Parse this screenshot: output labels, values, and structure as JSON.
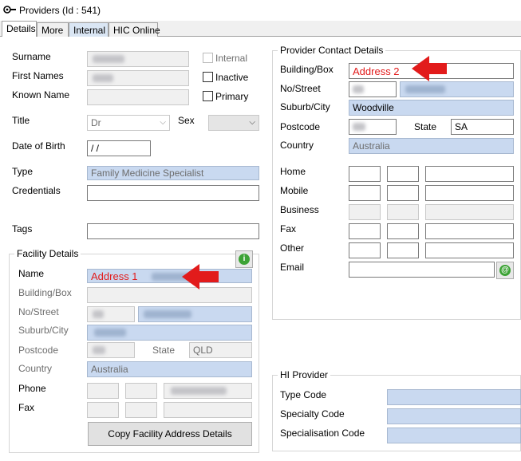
{
  "window": {
    "title": "Providers (Id : 541)"
  },
  "tabs": [
    {
      "label": "Details"
    },
    {
      "label": "More"
    },
    {
      "label": "Internal"
    },
    {
      "label": "HIC Online"
    }
  ],
  "personal": {
    "surname_label": "Surname",
    "first_names_label": "First Names",
    "known_name_label": "Known Name",
    "title_label": "Title",
    "title_value": "Dr",
    "sex_label": "Sex",
    "dob_label": "Date of Birth",
    "dob_value": "/ /",
    "type_label": "Type",
    "type_value": "Family Medicine Specialist",
    "credentials_label": "Credentials",
    "tags_label": "Tags",
    "internal_label": "Internal",
    "inactive_label": "Inactive",
    "primary_label": "Primary"
  },
  "facility": {
    "group_title": "Facility Details",
    "name_label": "Name",
    "name_annotation": "Address 1",
    "building_label": "Building/Box",
    "street_label": "No/Street",
    "suburb_label": "Suburb/City",
    "postcode_label": "Postcode",
    "state_label": "State",
    "state_value": "QLD",
    "country_label": "Country",
    "country_value": "Australia",
    "phone_label": "Phone",
    "fax_label": "Fax",
    "copy_button": "Copy Facility Address Details",
    "info_icon_glyph": "i"
  },
  "contact": {
    "group_title": "Provider Contact Details",
    "building_label": "Building/Box",
    "building_annotation": "Address 2",
    "street_label": "No/Street",
    "suburb_label": "Suburb/City",
    "suburb_value": "Woodville",
    "postcode_label": "Postcode",
    "state_label": "State",
    "state_value": "SA",
    "country_label": "Country",
    "country_value": "Australia",
    "home_label": "Home",
    "mobile_label": "Mobile",
    "business_label": "Business",
    "fax_label": "Fax",
    "other_label": "Other",
    "email_label": "Email",
    "email_icon_glyph": "@"
  },
  "hi_provider": {
    "group_title": "HI Provider",
    "type_code_label": "Type Code",
    "specialty_code_label": "Specialty Code",
    "specialisation_code_label": "Specialisation Code"
  },
  "colors": {
    "annotation_red": "#e21b1b",
    "field_blue": "#c9d9f0",
    "info_green": "#3da336"
  }
}
